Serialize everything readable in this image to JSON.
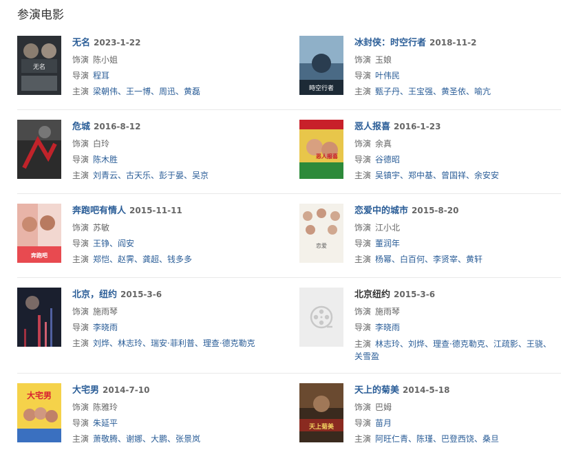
{
  "section": {
    "title": "参演电影"
  },
  "labels": {
    "role": "饰演",
    "director": "导演",
    "cast": "主演"
  },
  "movies": [
    {
      "title": "无名",
      "date": "2023-1-22",
      "role": "陈小姐",
      "director": "程耳",
      "cast": "梁朝伟、王一博、周迅、黄磊",
      "poster_icon": "poster-wuming"
    },
    {
      "title": "冰封侠：时空行者",
      "date": "2018-11-2",
      "role": "玉娘",
      "director": "叶伟民",
      "cast": "甄子丹、王宝强、黄圣依、喻亢",
      "poster_icon": "poster-bingfengxia"
    },
    {
      "title": "危城",
      "date": "2016-8-12",
      "role": "白玲",
      "director": "陈木胜",
      "cast": "刘青云、古天乐、彭于晏、吴京",
      "poster_icon": "poster-weicheng"
    },
    {
      "title": "恶人报喜",
      "date": "2016-1-23",
      "role": "余真",
      "director": "谷德昭",
      "cast": "吴镇宇、郑中基、曾国祥、余安安",
      "poster_icon": "poster-erenbaoxi"
    },
    {
      "title": "奔跑吧有情人",
      "date": "2015-11-11",
      "role": "苏敏",
      "director": "王铮、阎安",
      "cast": "郑恺、赵霁、龚超、钱多多",
      "poster_icon": "poster-benpao"
    },
    {
      "title": "恋爱中的城市",
      "date": "2015-8-20",
      "role": "江小北",
      "director": "董润年",
      "cast": "杨幂、白百何、李贤宰、黄轩",
      "poster_icon": "poster-lianai"
    },
    {
      "title": "北京，纽约",
      "date": "2015-3-6",
      "role": "施雨琴",
      "director": "李晓雨",
      "cast": "刘烨、林志玲、瑞安·菲利普、理查·德克勒克",
      "poster_icon": "poster-beijing-newyork"
    },
    {
      "title": "北京纽约",
      "date": "2015-3-6",
      "role": "施雨琴",
      "director": "李晓雨",
      "cast_line1": "林志玲、刘烨、理查·德克勒克、江疏影、王骁、",
      "cast_line2": "关雪盈",
      "poster_icon": "film-reel-placeholder-icon"
    },
    {
      "title": "大宅男",
      "date": "2014-7-10",
      "role": "陈雅玲",
      "director": "朱延平",
      "cast": "萧敬腾、谢娜、大鹏、张景岚",
      "poster_icon": "poster-dazhainan"
    },
    {
      "title": "天上的菊美",
      "date": "2014-5-18",
      "role": "巴姆",
      "director": "苗月",
      "cast": "阿旺仁青、陈瑾、巴登西饶、桑旦",
      "poster_icon": "poster-tianshang"
    }
  ],
  "colors": {
    "link": "#2a5d97",
    "muted": "#666666",
    "divider": "#e8e8e8"
  }
}
